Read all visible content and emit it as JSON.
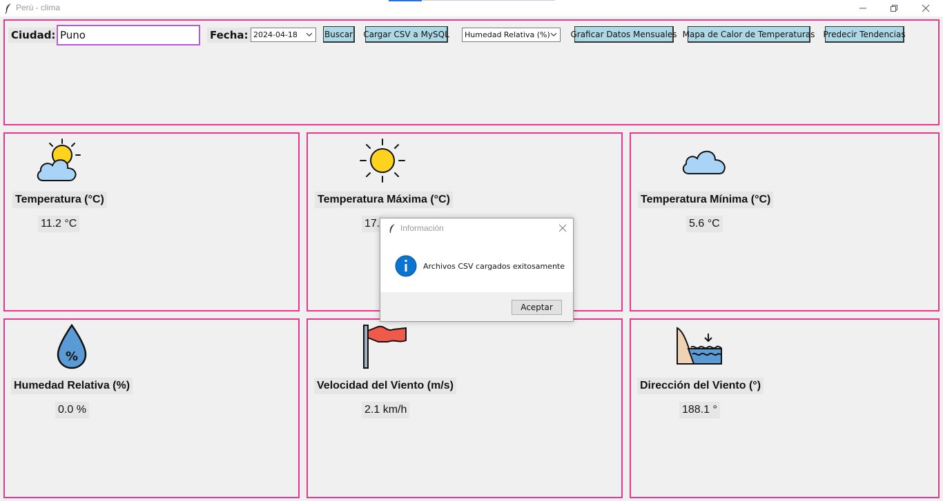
{
  "window": {
    "title": "Perú - clima",
    "controls": [
      "minimize-icon",
      "restore-icon",
      "close-icon"
    ]
  },
  "search": {
    "city_label": "Ciudad:",
    "city_value": "Puno",
    "date_label": "Fecha:",
    "date_value": "2024-04-18",
    "search_button": "Buscar",
    "load_csv_button": "Cargar CSV a MySQL",
    "variable_select": "Humedad Relativa (%)",
    "monthly_chart_button": "Graficar Datos Mensuales",
    "heatmap_button": "Mapa de Calor de Temperaturas",
    "predict_button": "Predecir Tendencias"
  },
  "cards": {
    "temperature": {
      "title": "Temperatura (°C)",
      "value": "11.2 °C",
      "icon": "partly-cloudy-icon"
    },
    "max_temperature": {
      "title": "Temperatura Máxima (°C)",
      "value": "17.",
      "icon": "sun-icon"
    },
    "min_temperature": {
      "title": "Temperatura Mínima (°C)",
      "value": "5.6 °C",
      "icon": "cloud-icon"
    },
    "humidity": {
      "title": "Humedad Relativa (%)",
      "value": "0.0 %",
      "icon": "humidity-drop-icon"
    },
    "wind_speed": {
      "title": "Velocidad del Viento (m/s)",
      "value": "2.1 km/h",
      "icon": "wind-flag-icon"
    },
    "wind_direction": {
      "title": "Dirección del Viento (°)",
      "value": "188.1 °",
      "icon": "water-level-icon"
    }
  },
  "dialog": {
    "title": "Información",
    "message": "Archivos CSV cargados exitosamente",
    "ok_button": "Aceptar",
    "icon": "info-icon"
  },
  "colors": {
    "frame_border": "#e8368f",
    "button_bg": "#add8e6",
    "input_focus_border": "#bb55dd",
    "info_icon": "#0a74d0"
  }
}
